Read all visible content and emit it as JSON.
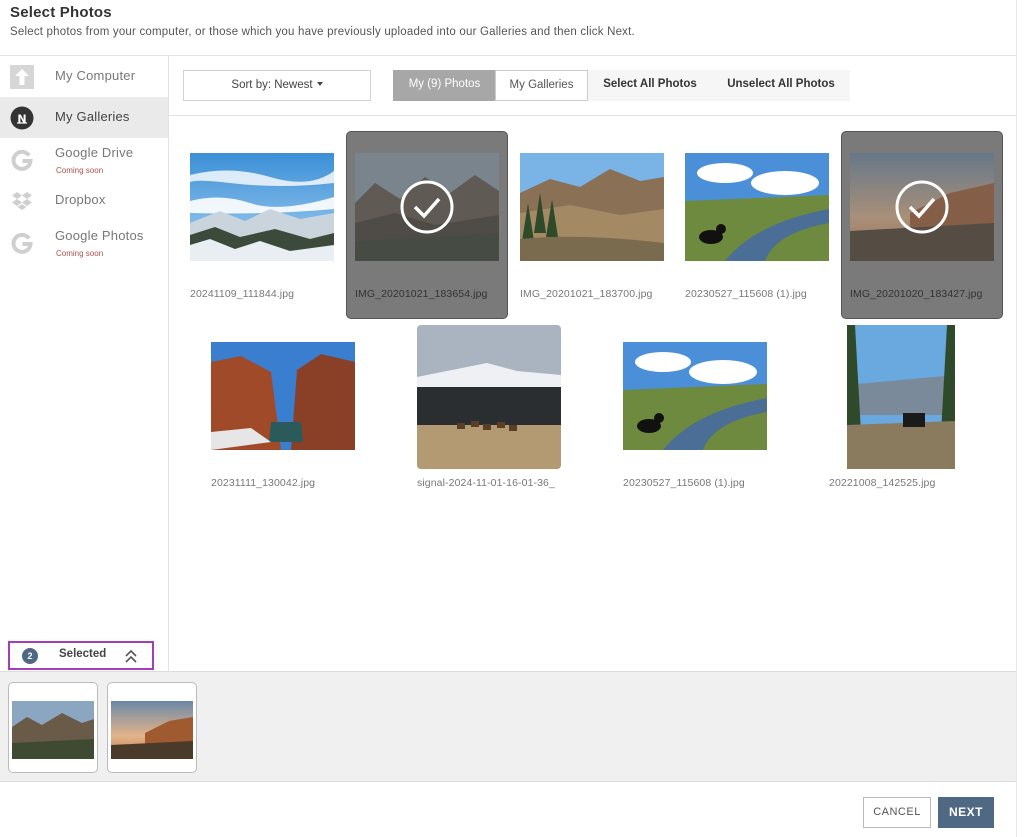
{
  "header": {
    "title": "Select Photos",
    "subtitle": "Select photos from your computer, or those which you have previously uploaded into our Galleries and then click Next."
  },
  "sidebar": {
    "items": [
      {
        "label": "My Computer",
        "icon": "upload-arrow-icon",
        "sub": ""
      },
      {
        "label": "My Galleries",
        "icon": "nl-logo-icon",
        "sub": ""
      },
      {
        "label": "Google Drive",
        "icon": "google-g-icon",
        "sub": "Coming soon"
      },
      {
        "label": "Dropbox",
        "icon": "dropbox-icon",
        "sub": ""
      },
      {
        "label": "Google Photos",
        "icon": "google-g-icon",
        "sub": "Coming soon"
      }
    ],
    "active_index": 1
  },
  "selection": {
    "count": "2",
    "label": "Selected"
  },
  "toolbar": {
    "sort_label": "Sort by: Newest",
    "tabs": [
      {
        "label": "My (9) Photos"
      },
      {
        "label": "My Galleries"
      },
      {
        "label": "Select All Photos"
      },
      {
        "label": "Unselect All Photos"
      }
    ]
  },
  "photos": [
    {
      "name": "20241109_111844.jpg",
      "selected": false,
      "scene": "snowy-mountains"
    },
    {
      "name": "IMG_20201021_183654.jpg",
      "selected": true,
      "scene": "dusk-mountains"
    },
    {
      "name": "IMG_20201021_183700.jpg",
      "selected": false,
      "scene": "pine-valley"
    },
    {
      "name": "20230527_115608 (1).jpg",
      "selected": false,
      "scene": "river-dog"
    },
    {
      "name": "IMG_20201020_183427.jpg",
      "selected": true,
      "scene": "sunset-cliffs"
    },
    {
      "name": "20231111_130042.jpg",
      "selected": false,
      "scene": "red-canyon"
    },
    {
      "name": "signal-2024-11-01-16-01-36_",
      "selected": false,
      "scene": "elk-meadow"
    },
    {
      "name": "20230527_115608 (1).jpg",
      "selected": false,
      "scene": "river-dog"
    },
    {
      "name": "20221008_142525.jpg",
      "selected": false,
      "scene": "atv-trail"
    }
  ],
  "footer": {
    "cancel_label": "CANCEL",
    "next_label": "NEXT"
  },
  "colors": {
    "accent": "#4f6883",
    "highlight": "#a63db8",
    "coming_soon": "#b0504a"
  }
}
